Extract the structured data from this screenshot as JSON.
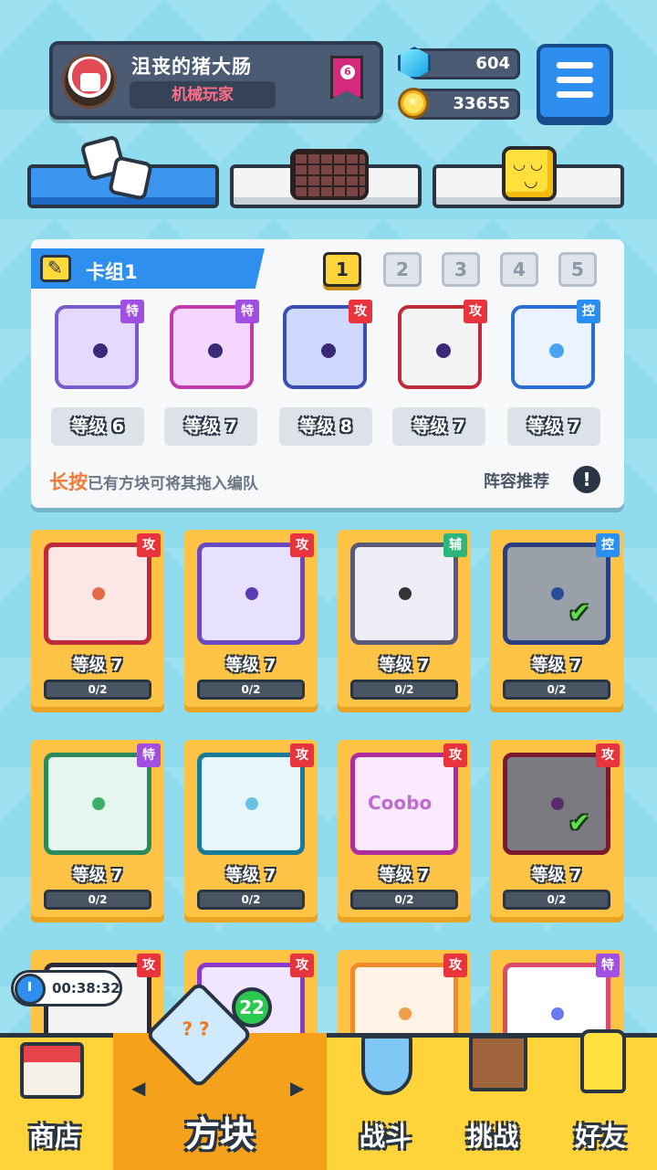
{
  "player": {
    "name": "沮丧的猪大肠",
    "title": "机械玩家",
    "rank": "6"
  },
  "currency": {
    "gems": "604",
    "coins": "33655"
  },
  "deck": {
    "title": "卡组1",
    "numbers": [
      "1",
      "2",
      "3",
      "4",
      "5"
    ],
    "cards": [
      {
        "tag": "特",
        "level": "等级 6"
      },
      {
        "tag": "特",
        "level": "等级 7"
      },
      {
        "tag": "攻",
        "level": "等级 8"
      },
      {
        "tag": "攻",
        "level": "等级 7"
      },
      {
        "tag": "控",
        "level": "等级 7"
      }
    ],
    "hint_highlight": "长按",
    "hint_text": "已有方块可将其拖入编队",
    "recommend": "阵容推荐"
  },
  "collection": [
    {
      "tag": "攻",
      "level": "等级 7",
      "progress": "0/2"
    },
    {
      "tag": "攻",
      "level": "等级 7",
      "progress": "0/2"
    },
    {
      "tag": "辅",
      "level": "等级 7",
      "progress": "0/2"
    },
    {
      "tag": "控",
      "level": "等级 7",
      "progress": "0/2"
    },
    {
      "tag": "特",
      "level": "等级 7",
      "progress": "0/2"
    },
    {
      "tag": "攻",
      "level": "等级 7",
      "progress": "0/2"
    },
    {
      "tag": "攻",
      "level": "等级 7",
      "progress": "0/2"
    },
    {
      "tag": "攻",
      "level": "等级 7",
      "progress": "0/2"
    },
    {
      "tag": "攻"
    },
    {
      "tag": "攻"
    },
    {
      "tag": "攻"
    },
    {
      "tag": "特"
    }
  ],
  "combo_label": "Coobo",
  "timer": "00:38:32",
  "nav": {
    "shop": "商店",
    "blocks": "方块",
    "blocks_badge": "22",
    "battle": "战斗",
    "challenge": "挑战",
    "friends": "好友"
  }
}
